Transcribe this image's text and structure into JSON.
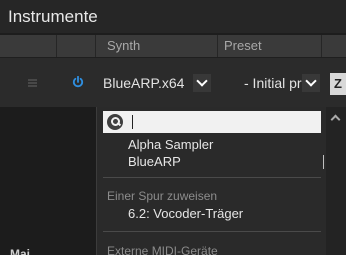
{
  "panel": {
    "title": "Instrumente"
  },
  "columns": {
    "synth": "Synth",
    "preset": "Preset"
  },
  "track": {
    "synth": "BlueARP.x64",
    "preset": "- Initial pr...",
    "edge_label": "Z"
  },
  "left": {
    "label": "Mai"
  },
  "dropdown": {
    "search_value": "",
    "items": [
      "Alpha Sampler",
      "BlueARP"
    ],
    "assign_section": "Einer Spur zuweisen",
    "assign_items": [
      "6.2: Vocoder-Träger"
    ],
    "midi_section": "Externe MIDI-Geräte"
  },
  "colors": {
    "power": "#2f8fe0",
    "background": "#1d1d1d"
  },
  "icons": {
    "power": "power-icon",
    "search": "search-icon",
    "synth_dropdown": "chevron-down-icon",
    "preset_dropdown": "chevron-down-icon",
    "scroll": "chevron-up-icon"
  }
}
